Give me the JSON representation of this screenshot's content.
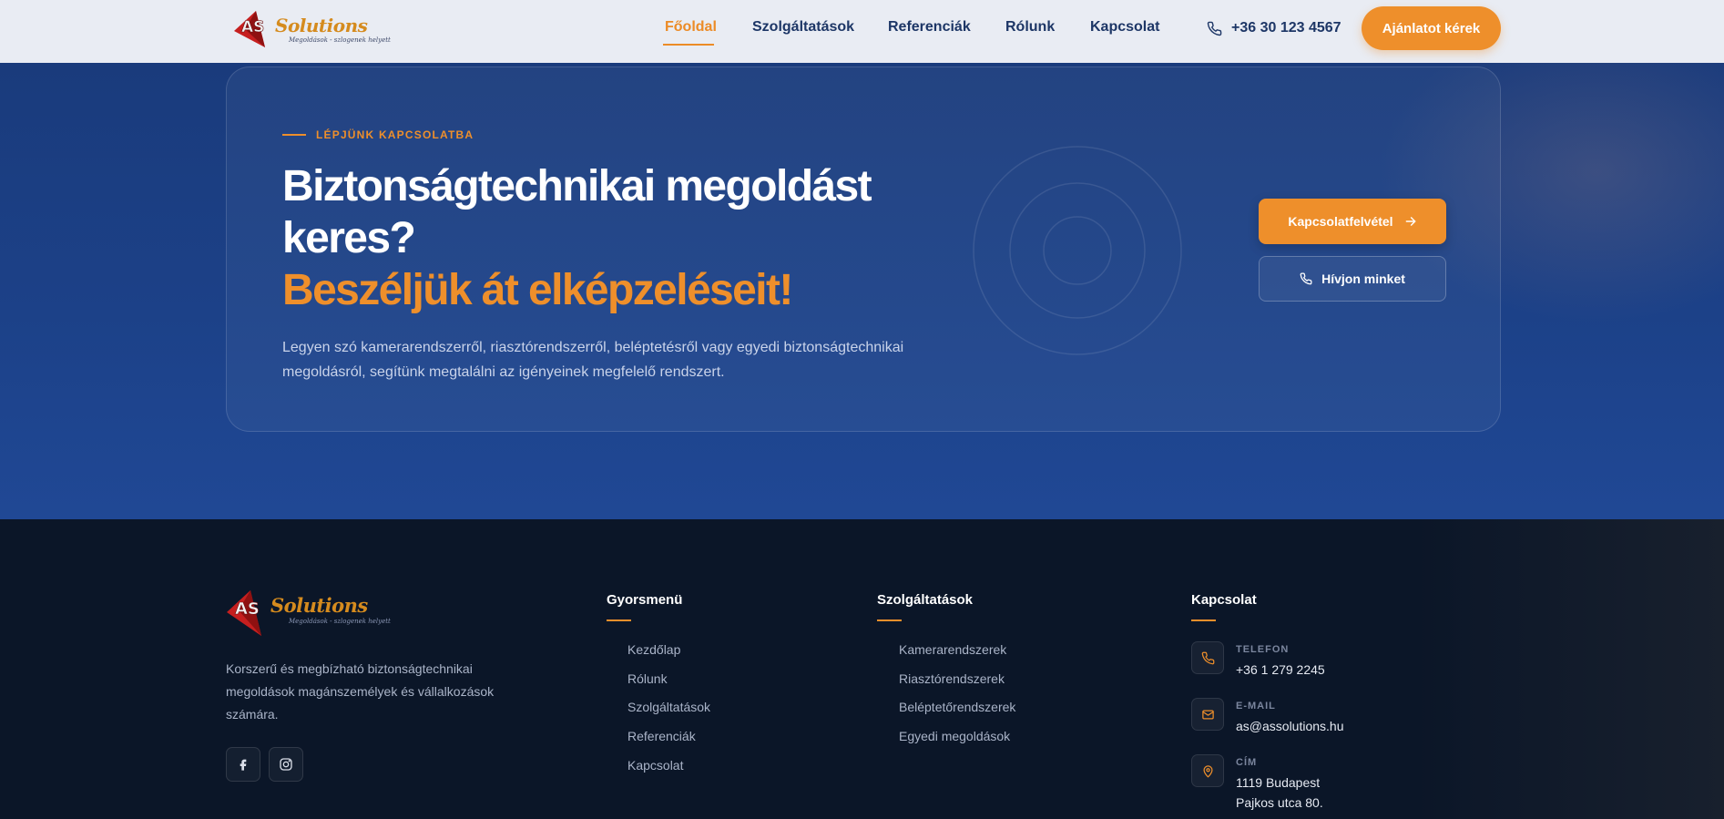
{
  "brand": {
    "logo_text": "AS Solutions",
    "tagline": "Megoldások - szlogenek helyett",
    "colors": {
      "accent": "#ee8f2b",
      "navy": "#1d3666",
      "logo_red": "#c61f1f"
    }
  },
  "nav": {
    "links": [
      {
        "label": "Főoldal",
        "active": true
      },
      {
        "label": "Szolgáltatások",
        "active": false
      },
      {
        "label": "Referenciák",
        "active": false
      },
      {
        "label": "Rólunk",
        "active": false
      },
      {
        "label": "Kapcsolat",
        "active": false
      }
    ],
    "phone": "+36 30 123 4567",
    "phone_icon": "phone-icon",
    "cta": "Ajánlatot kérek"
  },
  "hero": {
    "eyebrow": "LÉPJÜNK KAPCSOLATBA",
    "headline": "Biztonságtechnikai megoldást keres?",
    "headline_accent": "Beszéljük át elképzeléseit!",
    "description": "Legyen szó kamerarendszerről, riasztórendszerről, beléptetésről vagy egyedi biztonságtechnikai megoldásról, segítünk megtalálni az igényeinek megfelelő rendszert.",
    "primary_button": "Kapcsolatfelvétel",
    "primary_icon": "arrow-right-icon",
    "secondary_button": "Hívjon minket",
    "secondary_icon": "phone-icon"
  },
  "footer": {
    "description": "Korszerű és megbízható biztonságtechnikai megoldások magánszemélyek és vállalkozások számára.",
    "social": [
      "facebook-icon",
      "instagram-icon"
    ],
    "quick_menu": {
      "title": "Gyorsmenü",
      "links": [
        "Kezdőlap",
        "Rólunk",
        "Szolgáltatások",
        "Referenciák",
        "Kapcsolat"
      ]
    },
    "services": {
      "title": "Szolgáltatások",
      "links": [
        "Kamerarendszerek",
        "Riasztórendszerek",
        "Beléptetőrendszerek",
        "Egyedi megoldások"
      ]
    },
    "contact": {
      "title": "Kapcsolat",
      "phone_label": "TELEFON",
      "phone": "+36 1 279 2245",
      "email_label": "E-MAIL",
      "email": "as@assolutions.hu",
      "address_label": "CÍM",
      "address_line1": "1119 Budapest",
      "address_line2": "Pajkos utca 80."
    }
  }
}
